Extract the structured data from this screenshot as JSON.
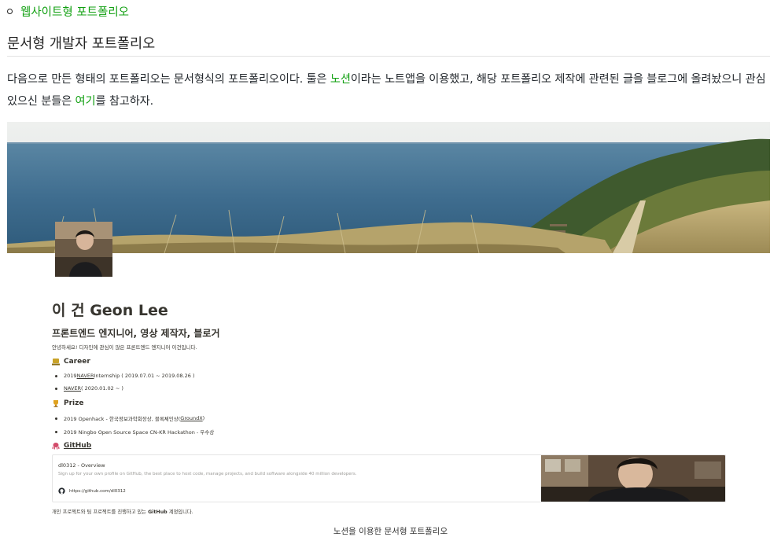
{
  "bullet": {
    "link_text": "웹사이트형 포트폴리오"
  },
  "section": {
    "title": "문서형 개발자 포트폴리오"
  },
  "paragraph": {
    "part1": "다음으로 만든 형태의 포트폴리오는 문서형식의 포트폴리오이다. 툴은 ",
    "link1": "노션",
    "part2": "이라는 노트앱을 이용했고, 해당 포트폴리오 제작에 관련된 글을 블로그에 올려놨으니 관심있으신 분들은 ",
    "link2": "여기",
    "part3": "를 참고하자."
  },
  "screenshot": {
    "name": "이 건 Geon Lee",
    "role": "프론트엔드 엔지니어, 영상 제작자, 블로거",
    "intro": "안녕하세요! 디자인에 관심이 많은 프론트엔드 엔지니어 이건입니다.",
    "career_heading": "Career",
    "career_items": [
      {
        "pre": "2019 ",
        "link": "NAVER",
        "post": " Internship ( 2019.07.01 ~ 2019.08.26 )"
      },
      {
        "pre": "",
        "link": "NAVER",
        "post": " ( 2020.01.02 ~ )"
      }
    ],
    "prize_heading": "Prize",
    "prize_items": [
      {
        "pre": "2019 Openhack - 한국정보과학회장상, 블록체인상(",
        "link": "GroundX",
        "post": ")"
      },
      {
        "pre": "2019 Ningbo Open Source Space CN-KR Hackathon - 우수상",
        "link": "",
        "post": ""
      }
    ],
    "github_heading": "GitHub",
    "github_card": {
      "title": "dl0312 - Overview",
      "desc": "Sign up for your own profile on GitHub, the best place to host code, manage projects, and build software alongside 40 million developers.",
      "url": "https://github.com/dl0312"
    },
    "footer_pre": "개인 프로젝트와 팀 프로젝트를 진행하고 있는 ",
    "footer_bold": "GitHub",
    "footer_post": " 계정입니다."
  },
  "caption": "노션을 이용한 문서형 포트폴리오",
  "colors": {
    "link_green": "#12a012",
    "sea": "#3d6b8c",
    "grass": "#b9a46a"
  },
  "icons": [
    "computer-icon",
    "trophy-icon",
    "octopus-icon",
    "github-icon"
  ]
}
